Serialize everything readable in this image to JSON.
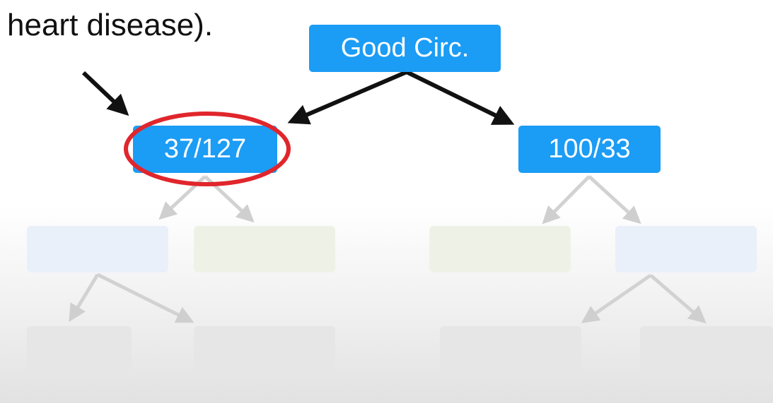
{
  "caption": "heart disease).",
  "tree": {
    "root_label": "Good Circ.",
    "left_child_label": "37/127",
    "right_child_label": "100/33"
  },
  "colors": {
    "node_fill": "#1b9cf5",
    "node_text": "#ffffff",
    "highlight_ring": "#e0262c",
    "arrow": "#111111"
  }
}
